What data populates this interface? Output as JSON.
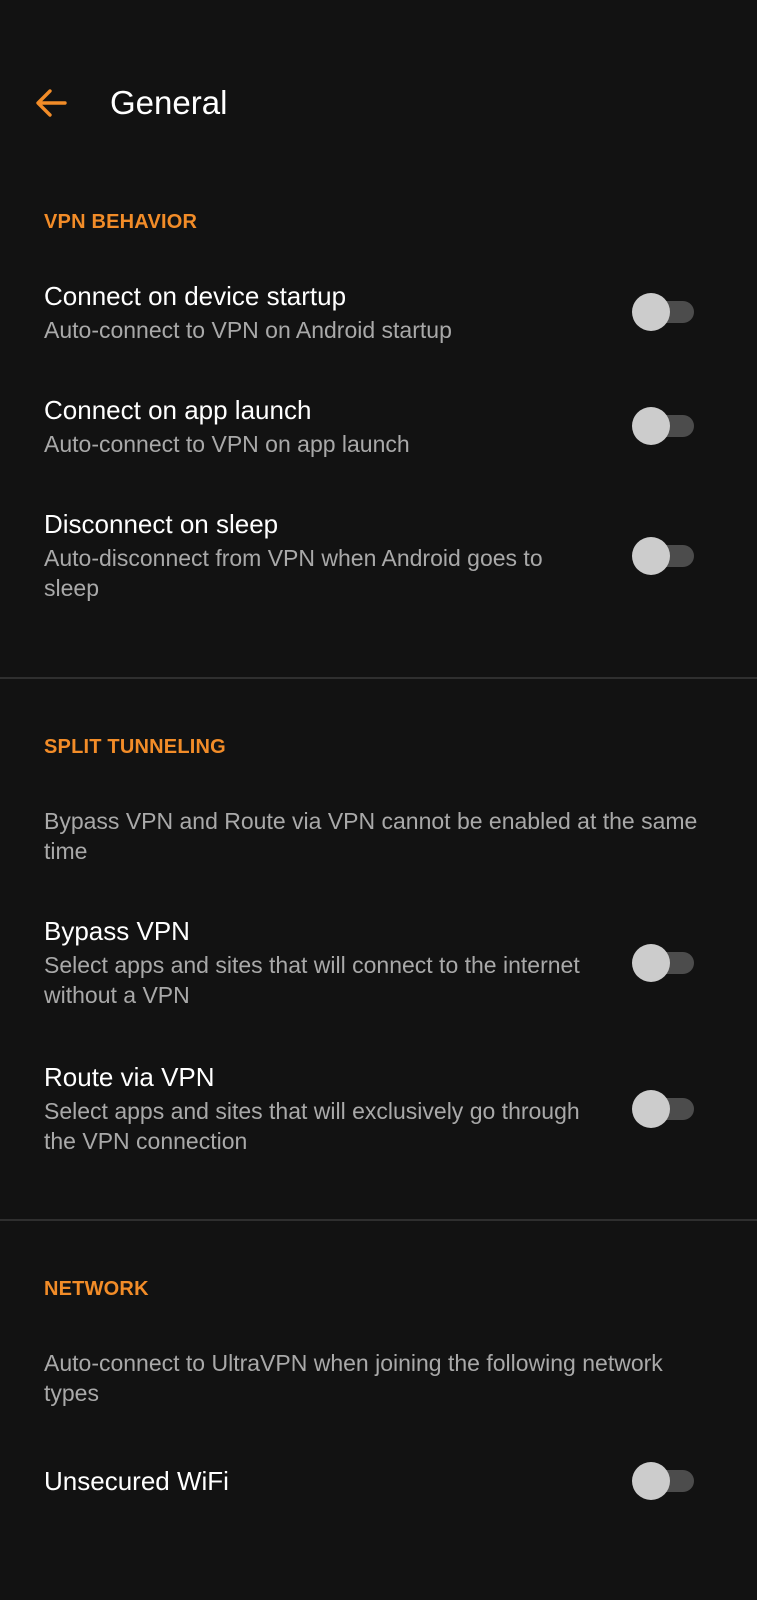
{
  "header": {
    "title": "General",
    "back_icon": "arrow-left-icon",
    "accent": "#f28c28"
  },
  "vpn_behavior": {
    "header": "VPN BEHAVIOR",
    "items": [
      {
        "title": "Connect on device startup",
        "subtitle": "Auto-connect to VPN on Android startup",
        "enabled": false
      },
      {
        "title": "Connect on app launch",
        "subtitle": "Auto-connect to VPN on app launch",
        "enabled": false
      },
      {
        "title": "Disconnect on sleep",
        "subtitle": "Auto-disconnect from VPN when Android goes to sleep",
        "enabled": false
      }
    ]
  },
  "split_tunneling": {
    "header": "SPLIT TUNNELING",
    "note": "Bypass VPN and Route via VPN cannot be enabled at the same time",
    "items": [
      {
        "title": "Bypass VPN",
        "subtitle": "Select apps and sites that will connect to the internet without a VPN",
        "enabled": false
      },
      {
        "title": "Route via VPN",
        "subtitle": "Select apps and sites that will exclusively go through the VPN connection",
        "enabled": false
      }
    ]
  },
  "network": {
    "header": "NETWORK",
    "note": "Auto-connect to UltraVPN when joining the following network types",
    "items": [
      {
        "title": "Unsecured WiFi",
        "enabled": false
      }
    ]
  }
}
